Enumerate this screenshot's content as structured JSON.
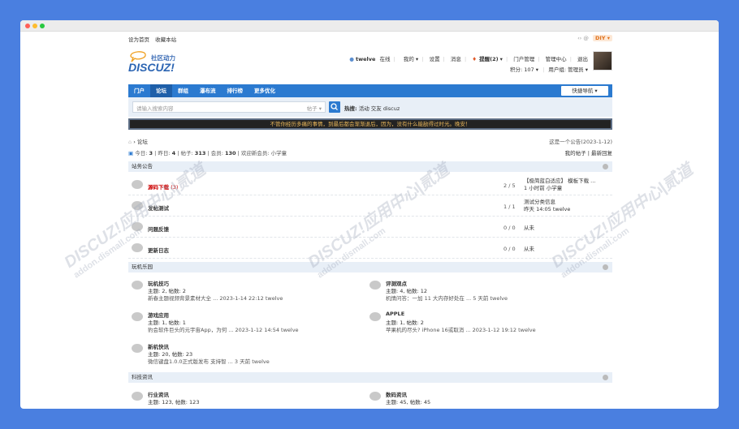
{
  "topbar": {
    "links": [
      "设为首页",
      "收藏本站"
    ],
    "diy": "DIY"
  },
  "logo": {
    "subtitle": "社区动力",
    "main": "DISCUZ!"
  },
  "usernav": {
    "username": "twelve",
    "status": "在线",
    "items": [
      "我的",
      "设置",
      "消息",
      "提醒(2)",
      "门户管理",
      "管理中心",
      "退出"
    ],
    "points": "积分: 107",
    "usergroup": "用户组: 管理员"
  },
  "nav": {
    "items": [
      "门户",
      "论坛",
      "群组",
      "瀑布流",
      "排行榜",
      "更多优化"
    ],
    "quick": "快捷导航"
  },
  "search": {
    "placeholder": "请输入搜索内容",
    "type": "帖子",
    "hot_label": "热搜:",
    "hot_words": [
      "活动",
      "交友",
      "discuz"
    ]
  },
  "notice": "不管你经历多痛的事情，到最后都会渐渐退后，因为，没有什么能敌得过时光。晚安！",
  "breadcrumb": {
    "current": "论坛",
    "announcement": "这是一个公告(2023-1-12)"
  },
  "stats": {
    "today_label": "今日:",
    "today": "3",
    "yesterday_label": "昨日:",
    "yesterday": "4",
    "posts_label": "帖子:",
    "posts": "313",
    "members_label": "会员:",
    "members": "130",
    "welcome": "欢迎新会员: 小学童",
    "my_posts": "我的帖子",
    "latest": "最新回复"
  },
  "sections": [
    {
      "title": "站务公告",
      "forums": [
        {
          "name": "源码下载",
          "new": "(3)",
          "ratio": "2 / 5",
          "last1": "【极简蓝白适应】 模板下载 ...",
          "last2": "1 小时前 小学童"
        },
        {
          "name": "发帖测试",
          "new": "",
          "ratio": "1 / 1",
          "last1": "测试分类信息",
          "last2": "昨天 14:05 twelve"
        },
        {
          "name": "问题反馈",
          "new": "",
          "ratio": "0 / 0",
          "last1": "从未",
          "last2": ""
        },
        {
          "name": "更新日志",
          "new": "",
          "ratio": "0 / 0",
          "last1": "从未",
          "last2": ""
        }
      ]
    },
    {
      "title": "玩机乐园",
      "forums": [
        {
          "name": "玩机技巧",
          "counts": "主题: 2, 帖数: 2",
          "last": "新春主题视频背景素材大全 ... 2023-1-14 22:12 twelve"
        },
        {
          "name": "评测观点",
          "counts": "主题: 4, 帖数: 12",
          "last": "机情问答：一加 11 大内存好处在 ... 5 天前 twelve"
        },
        {
          "name": "游戏应用",
          "counts": "主题: 1, 帖数: 1",
          "last": "豹会软件巨头的元宇宙App，为何 ... 2023-1-12 14:54 twelve"
        },
        {
          "name": "APPLE",
          "counts": "主题: 1, 帖数: 2",
          "last": "苹果机的尽头? iPhone 16或取消 ... 2023-1-12 19:12 twelve"
        },
        {
          "name": "新机快讯",
          "counts": "主题: 20, 帖数: 23",
          "last": "微信键盘1.0.0正式版发布 支持智 ... 3 天前 twelve"
        }
      ]
    },
    {
      "title": "科技资讯",
      "forums": [
        {
          "name": "行业资讯",
          "counts": "主题: 123, 帖数: 123"
        },
        {
          "name": "数码资讯",
          "counts": "主题: 45, 帖数: 45"
        }
      ]
    }
  ],
  "watermark": {
    "main": "DISCUZ!应用中心|贰道",
    "sub": "addon.dismall.com"
  }
}
